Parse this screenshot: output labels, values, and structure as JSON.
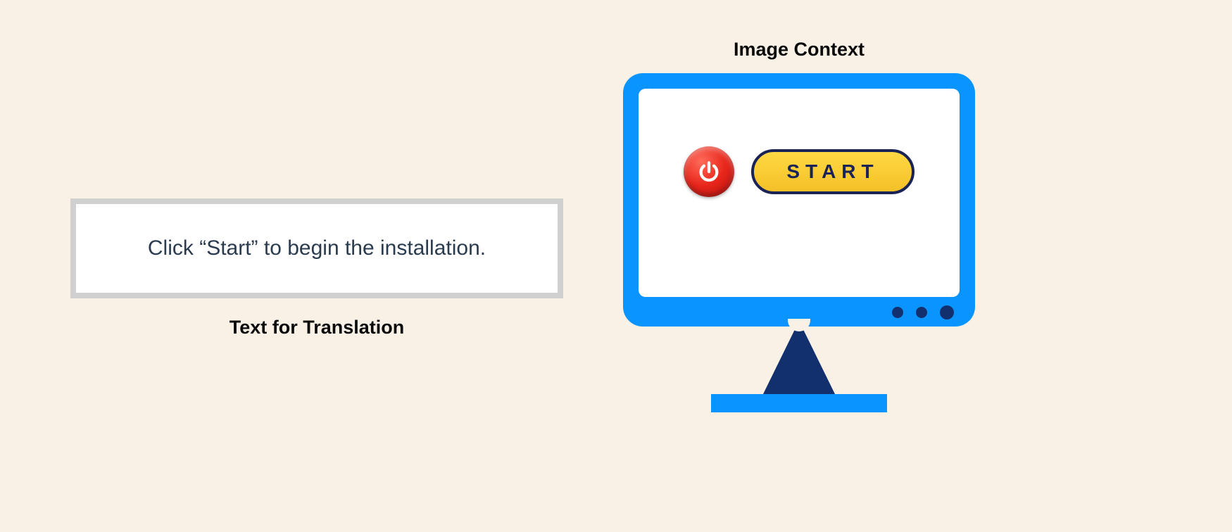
{
  "left": {
    "text": "Click “Start” to begin the installation.",
    "caption": "Text for Translation"
  },
  "right": {
    "caption": "Image Context",
    "start_label": "START"
  }
}
